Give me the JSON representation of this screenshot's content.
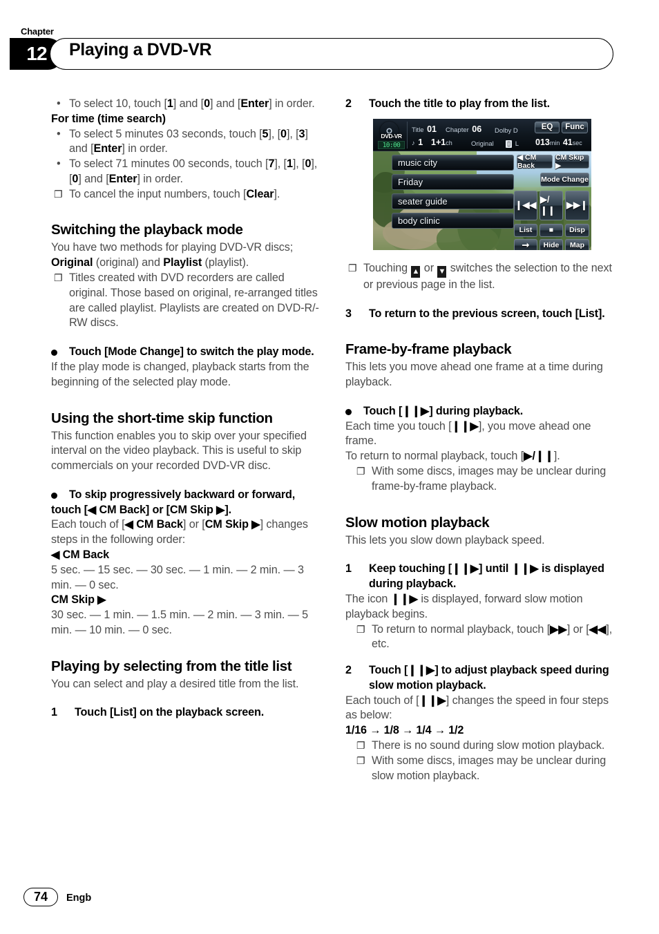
{
  "header": {
    "chapter_label": "Chapter",
    "chapter_number": "12",
    "title": "Playing a DVD-VR"
  },
  "left_column": {
    "bullet_select_10": "To select 10, touch [<b>1</b>] and [<b>0</b>] and [<b>Enter</b>] in order.",
    "for_time_heading": "For time (time search)",
    "bullet_5min": "To select 5 minutes 03 seconds, touch [<b>5</b>], [<b>0</b>], [<b>3</b>] and [<b>Enter</b>] in order.",
    "bullet_71min": "To select 71 minutes 00 seconds, touch [<b>7</b>], [<b>1</b>], [<b>0</b>], [<b>0</b>] and [<b>Enter</b>] in order.",
    "note_cancel": "To cancel the input numbers, touch [<b>Clear</b>].",
    "switching_heading": "Switching the playback mode",
    "switching_body": "You have two methods for playing DVD-VR discs; <b>Original</b> (original) and <b>Playlist</b> (playlist).",
    "switching_note": "Titles created with DVD recorders are called original. Those based on original, re-arranged titles are called playlist. Playlists are created on DVD-R/-RW discs.",
    "mode_change_step": "Touch [Mode Change] to switch the play mode.",
    "mode_change_body": "If the play mode is changed, playback starts from the beginning of the selected play mode.",
    "skip_heading": "Using the short-time skip function",
    "skip_body": "This function enables you to skip over your specified interval on the video playback. This is useful to skip commercials on your recorded DVD-VR disc.",
    "skip_step": "To skip progressively backward or forward, touch [◀ CM Back] or [CM Skip ▶].",
    "skip_step_body": "Each touch of [<b>◀ CM Back</b>] or [<b>CM Skip ▶</b>] changes steps in the following order:",
    "cm_back_label": "◀ CM Back",
    "cm_back_values": "5 sec. — 15 sec. — 30 sec. — 1 min. — 2 min. — 3 min. — 0 sec.",
    "cm_skip_label": "CM Skip ▶",
    "cm_skip_values": "30 sec. — 1 min. — 1.5 min. — 2 min. — 3 min. — 5 min. — 10 min. — 0 sec.",
    "title_list_heading": "Playing by selecting from the title list",
    "title_list_body": "You can select and play a desired title from the list.",
    "step1_num": "1",
    "step1_text": "Touch [List] on the playback screen."
  },
  "right_column": {
    "step2_num": "2",
    "step2_text": "Touch the title to play from the list.",
    "note_paging": "Touching <span class=\"inline-arrow\">▲</span> or <span class=\"inline-arrow\">▼</span> switches the selection to the next or previous page in the list.",
    "step3_num": "3",
    "step3_text": "To return to the previous screen, touch [List].",
    "frame_heading": "Frame-by-frame playback",
    "frame_body": "This lets you move ahead one frame at a time during playback.",
    "frame_step": "Touch [❙❙▶] during playback.",
    "frame_step_body": "Each time you touch [<b>❙❙▶</b>], you move ahead one frame.",
    "frame_return": "To return to normal playback, touch [<b>▶/❙❙</b>].",
    "frame_note": "With some discs, images may be unclear during frame-by-frame playback.",
    "slow_heading": "Slow motion playback",
    "slow_body": "This lets you slow down playback speed.",
    "slow_step1_num": "1",
    "slow_step1_text": "Keep touching [❙❙▶] until ❙❙▶ is displayed during playback.",
    "slow_step1_body": "The icon <b>❙❙▶</b> is displayed, forward slow motion playback begins.",
    "slow_step1_note": "To return to normal playback, touch [<b>▶▶</b>] or [<b>◀◀</b>], etc.",
    "slow_step2_num": "2",
    "slow_step2_text": "Touch [❙❙▶] to adjust playback speed during slow motion playback.",
    "slow_step2_body": "Each touch of [<b>❙❙▶</b>] changes the speed in four steps as below:",
    "slow_speeds": "1/16 → 1/8 → 1/4 → 1/2",
    "slow_note1": "There is no sound during slow motion playback.",
    "slow_note2": "With some discs, images may be unclear during slow motion playback."
  },
  "device_screenshot": {
    "disc_label": "DVD-VR",
    "lcd_time": "10:00",
    "title_label": "Title",
    "title_value": "01",
    "chapter_label": "Chapter",
    "chapter_value": "06",
    "audio_format": "Dolby D",
    "eq_button": "EQ",
    "func_button": "Func",
    "audio_note_icon": "♪",
    "audio_track": "1",
    "channel": "1+1",
    "channel_unit": "ch",
    "mode": "Original",
    "lock_icon": "🔒",
    "lock_label": "L",
    "time_min": "013",
    "time_min_unit": "min",
    "time_sec": "41",
    "time_sec_unit": "sec",
    "list_items": [
      "music city",
      "Friday",
      "seater guide",
      "body clinic"
    ],
    "cm_back_button": "◀ CM Back",
    "cm_skip_button": "CM Skip ▶",
    "mode_change_button": "Mode Change",
    "prev_button": "❙◀◀",
    "playpause_button": "▶/❙❙",
    "next_button": "▶▶❙",
    "list_button": "List",
    "stop_button": "■",
    "disp_button": "Disp",
    "arrow_button": "➞",
    "hide_button": "Hide",
    "map_button": "Map"
  },
  "footer": {
    "page_number": "74",
    "language": "Engb"
  }
}
